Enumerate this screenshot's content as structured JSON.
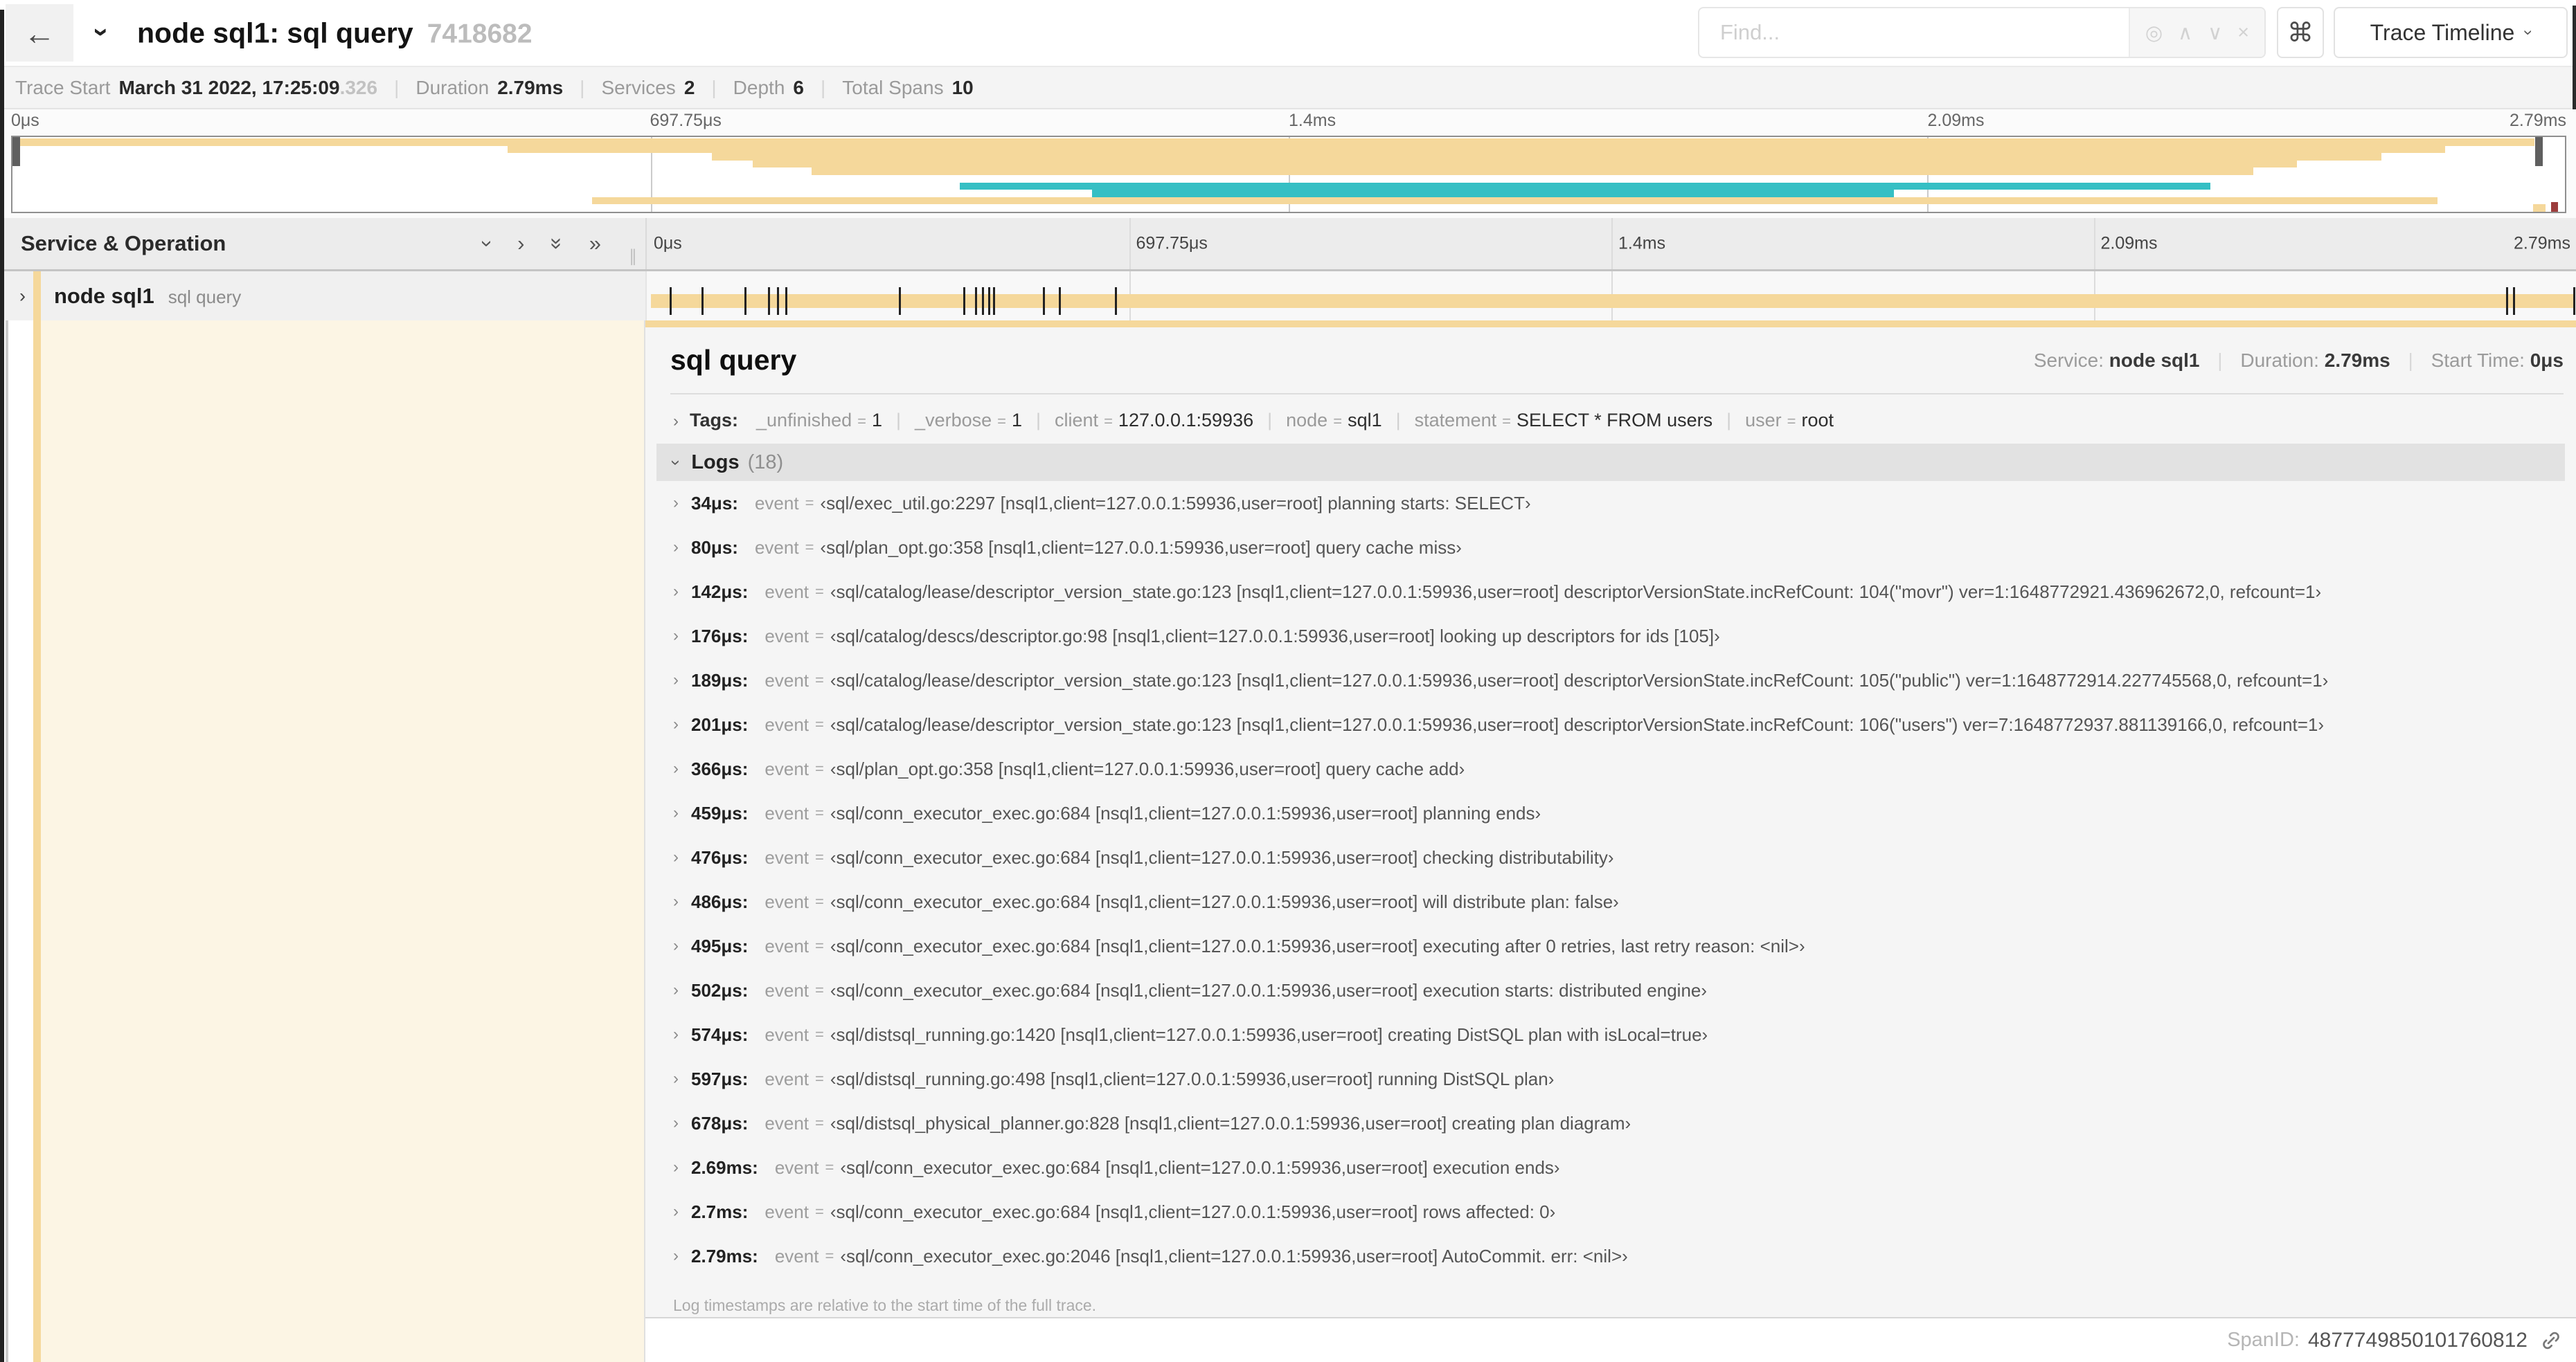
{
  "colors": {
    "accent": "#F5D89B",
    "secondary": "#35BFC4",
    "cream": "#FCF5E4",
    "red_marker": "#9C3C3C"
  },
  "icons": {
    "back_arrow": "←",
    "chevron": "›",
    "double_chevron": "»",
    "command": "⌘",
    "target": "◎",
    "up_arrow": "∧",
    "down_arrow": "∨",
    "close": "×",
    "resizer": "∥"
  },
  "header": {
    "title": "node sql1: sql query",
    "trace_id": "7418682",
    "find_placeholder": "Find...",
    "view_selector": "Trace Timeline"
  },
  "summary": {
    "items": [
      {
        "label": "Trace Start",
        "value": "March 31 2022, 17:25:09",
        "suffix": ".326"
      },
      {
        "label": "Duration",
        "value": "2.79ms"
      },
      {
        "label": "Services",
        "value": "2"
      },
      {
        "label": "Depth",
        "value": "6"
      },
      {
        "label": "Total Spans",
        "value": "10"
      }
    ]
  },
  "minimap": {
    "ticks": [
      "0μs",
      "697.75μs",
      "1.4ms",
      "2.09ms",
      "2.79ms"
    ],
    "bars": [
      {
        "row": 0,
        "start": 0.0,
        "end": 0.988,
        "color": "tan"
      },
      {
        "row": 1,
        "start": 0.194,
        "end": 0.953,
        "color": "tan"
      },
      {
        "row": 2,
        "start": 0.274,
        "end": 0.928,
        "color": "tan"
      },
      {
        "row": 3,
        "start": 0.29,
        "end": 0.895,
        "color": "tan"
      },
      {
        "row": 4,
        "start": 0.313,
        "end": 0.878,
        "color": "tan"
      },
      {
        "row": 6,
        "start": 0.371,
        "end": 0.861,
        "color": "teal"
      },
      {
        "row": 7,
        "start": 0.423,
        "end": 0.737,
        "color": "teal"
      },
      {
        "row": 8,
        "start": 0.227,
        "end": 0.95,
        "color": "tan"
      },
      {
        "row": 9,
        "start": 0.9875,
        "end": 0.9924,
        "color": "tan"
      }
    ]
  },
  "timeline": {
    "left_header": "Service & Operation",
    "ticks": [
      "0μs",
      "697.75μs",
      "1.4ms",
      "2.09ms",
      "2.79ms"
    ],
    "duration_us": 2790,
    "row": {
      "service": "node sql1",
      "operation": "sql query"
    }
  },
  "detail": {
    "operation": "sql query",
    "service_label": "Service:",
    "service_value": "node sql1",
    "duration_label": "Duration:",
    "duration_value": "2.79ms",
    "start_label": "Start Time:",
    "start_value": "0μs",
    "tags_label": "Tags:",
    "tags": [
      {
        "key": "_unfinished",
        "value": "1"
      },
      {
        "key": "_verbose",
        "value": "1"
      },
      {
        "key": "client",
        "value": "127.0.0.1:59936"
      },
      {
        "key": "node",
        "value": "sql1"
      },
      {
        "key": "statement",
        "value": "SELECT * FROM users"
      },
      {
        "key": "user",
        "value": "root"
      }
    ],
    "logs_label": "Logs",
    "logs_count": "(18)",
    "log_field": "event",
    "logs": [
      {
        "time": "34μs:",
        "value": "‹sql/exec_util.go:2297 [nsql1,client=127.0.0.1:59936,user=root] planning starts: SELECT›"
      },
      {
        "time": "80μs:",
        "value": "‹sql/plan_opt.go:358 [nsql1,client=127.0.0.1:59936,user=root] query cache miss›"
      },
      {
        "time": "142μs:",
        "value": "‹sql/catalog/lease/descriptor_version_state.go:123 [nsql1,client=127.0.0.1:59936,user=root] descriptorVersionState.incRefCount: 104(\"movr\") ver=1:1648772921.436962672,0, refcount=1›"
      },
      {
        "time": "176μs:",
        "value": "‹sql/catalog/descs/descriptor.go:98 [nsql1,client=127.0.0.1:59936,user=root] looking up descriptors for ids [105]›"
      },
      {
        "time": "189μs:",
        "value": "‹sql/catalog/lease/descriptor_version_state.go:123 [nsql1,client=127.0.0.1:59936,user=root] descriptorVersionState.incRefCount: 105(\"public\") ver=1:1648772914.227745568,0, refcount=1›"
      },
      {
        "time": "201μs:",
        "value": "‹sql/catalog/lease/descriptor_version_state.go:123 [nsql1,client=127.0.0.1:59936,user=root] descriptorVersionState.incRefCount: 106(\"users\") ver=7:1648772937.881139166,0, refcount=1›"
      },
      {
        "time": "366μs:",
        "value": "‹sql/plan_opt.go:358 [nsql1,client=127.0.0.1:59936,user=root] query cache add›"
      },
      {
        "time": "459μs:",
        "value": "‹sql/conn_executor_exec.go:684 [nsql1,client=127.0.0.1:59936,user=root] planning ends›"
      },
      {
        "time": "476μs:",
        "value": "‹sql/conn_executor_exec.go:684 [nsql1,client=127.0.0.1:59936,user=root] checking distributability›"
      },
      {
        "time": "486μs:",
        "value": "‹sql/conn_executor_exec.go:684 [nsql1,client=127.0.0.1:59936,user=root] will distribute plan: false›"
      },
      {
        "time": "495μs:",
        "value": "‹sql/conn_executor_exec.go:684 [nsql1,client=127.0.0.1:59936,user=root] executing after 0 retries, last retry reason: <nil>›"
      },
      {
        "time": "502μs:",
        "value": "‹sql/conn_executor_exec.go:684 [nsql1,client=127.0.0.1:59936,user=root] execution starts: distributed engine›"
      },
      {
        "time": "574μs:",
        "value": "‹sql/distsql_running.go:1420 [nsql1,client=127.0.0.1:59936,user=root] creating DistSQL plan with isLocal=true›"
      },
      {
        "time": "597μs:",
        "value": "‹sql/distsql_running.go:498 [nsql1,client=127.0.0.1:59936,user=root] running DistSQL plan›"
      },
      {
        "time": "678μs:",
        "value": "‹sql/distsql_physical_planner.go:828 [nsql1,client=127.0.0.1:59936,user=root] creating plan diagram›"
      },
      {
        "time": "2.69ms:",
        "value": "‹sql/conn_executor_exec.go:684 [nsql1,client=127.0.0.1:59936,user=root] execution ends›"
      },
      {
        "time": "2.7ms:",
        "value": "‹sql/conn_executor_exec.go:684 [nsql1,client=127.0.0.1:59936,user=root] rows affected: 0›"
      },
      {
        "time": "2.79ms:",
        "value": "‹sql/conn_executor_exec.go:2046 [nsql1,client=127.0.0.1:59936,user=root] AutoCommit. err: <nil>›"
      }
    ],
    "logs_note": "Log timestamps are relative to the start time of the full trace.",
    "spanid_label": "SpanID:",
    "spanid_value": "4877749850101760812"
  }
}
